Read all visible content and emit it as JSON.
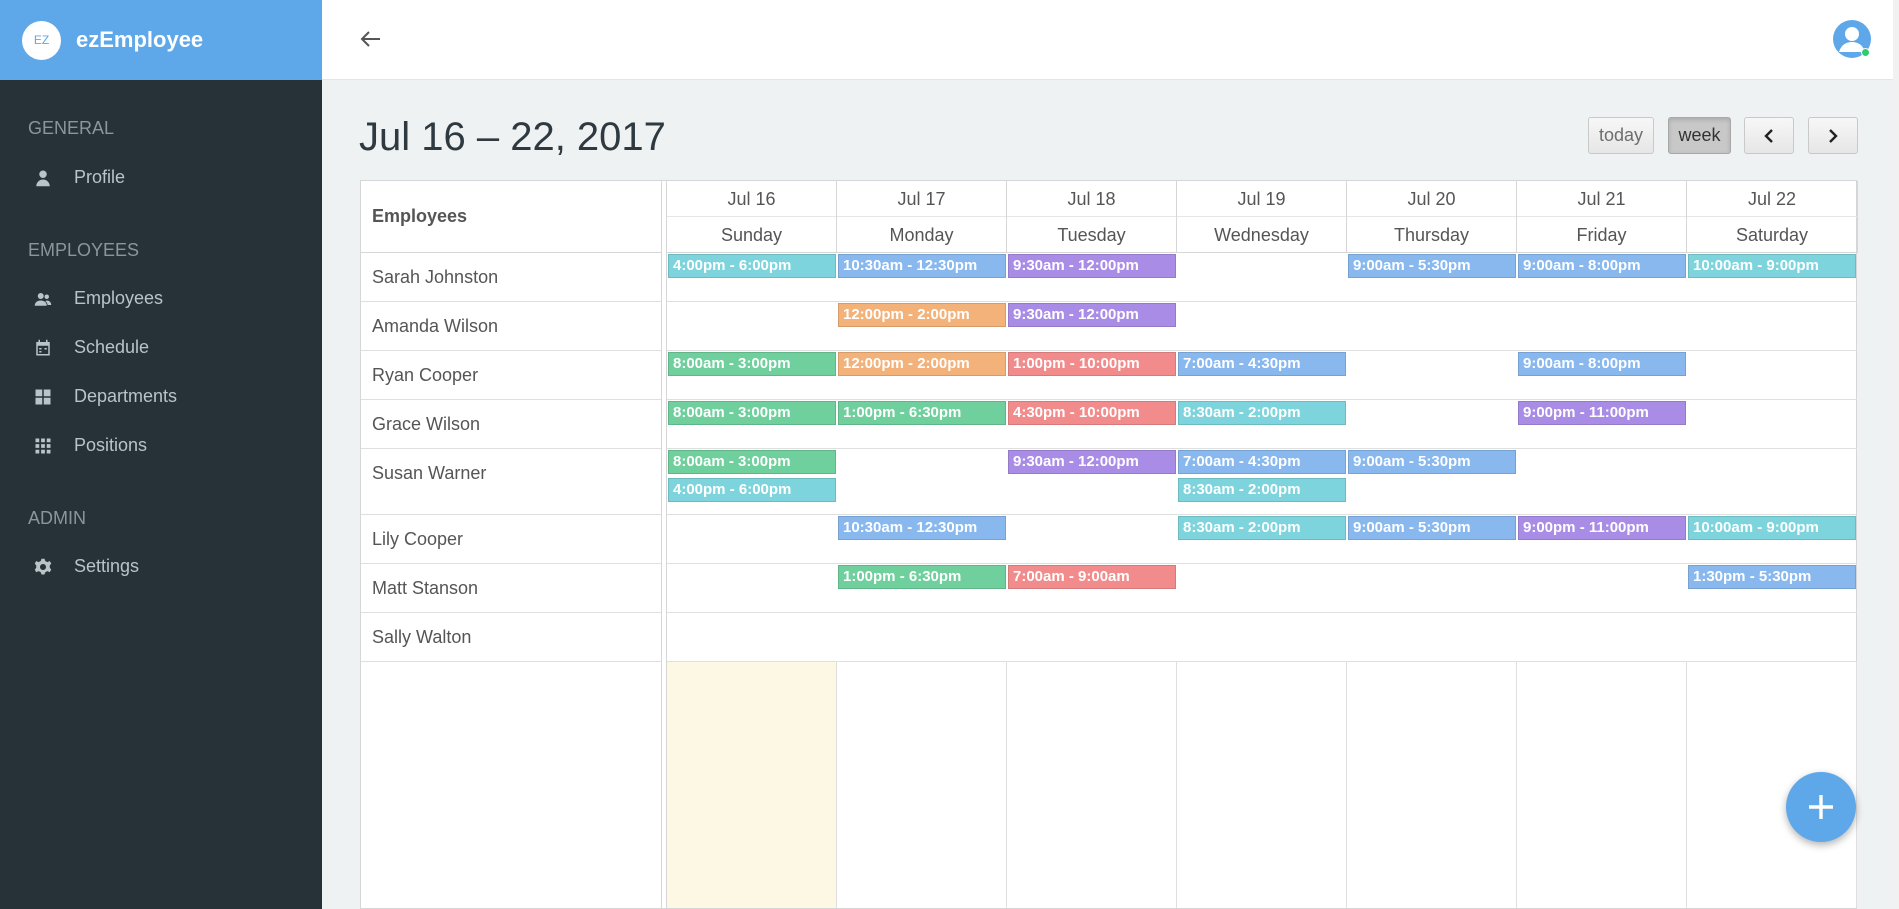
{
  "app": {
    "logo_text": "EZ",
    "name": "ezEmployee"
  },
  "sidebar": {
    "sections": [
      {
        "title": "GENERAL",
        "items": [
          {
            "label": "Profile",
            "icon": "user-icon"
          }
        ]
      },
      {
        "title": "EMPLOYEES",
        "items": [
          {
            "label": "Employees",
            "icon": "users-icon"
          },
          {
            "label": "Schedule",
            "icon": "calendar-icon"
          },
          {
            "label": "Departments",
            "icon": "grid-icon"
          },
          {
            "label": "Positions",
            "icon": "apps-icon"
          }
        ]
      },
      {
        "title": "ADMIN",
        "items": [
          {
            "label": "Settings",
            "icon": "gear-icon"
          }
        ]
      }
    ]
  },
  "toolbar": {
    "title": "Jul 16 – 22, 2017",
    "today_label": "today",
    "week_label": "week",
    "prev_icon": "chevron-left-icon",
    "next_icon": "chevron-right-icon",
    "active_view": "week"
  },
  "calendar": {
    "employees_header": "Employees",
    "days": [
      {
        "date": "Jul 16",
        "weekday": "Sunday"
      },
      {
        "date": "Jul 17",
        "weekday": "Monday"
      },
      {
        "date": "Jul 18",
        "weekday": "Tuesday"
      },
      {
        "date": "Jul 19",
        "weekday": "Wednesday"
      },
      {
        "date": "Jul 20",
        "weekday": "Thursday"
      },
      {
        "date": "Jul 21",
        "weekday": "Friday"
      },
      {
        "date": "Jul 22",
        "weekday": "Saturday"
      }
    ],
    "highlighted_day": "Jul 16",
    "employees": [
      {
        "name": "Sarah Johnston",
        "shifts": [
          {
            "day": 0,
            "slot": 0,
            "text": "4:00pm - 6:00pm",
            "color": "#7dd4dc"
          },
          {
            "day": 1,
            "slot": 0,
            "text": "10:30am - 12:30pm",
            "color": "#88b8ee"
          },
          {
            "day": 2,
            "slot": 0,
            "text": "9:30am - 12:00pm",
            "color": "#a98ce5"
          },
          {
            "day": 4,
            "slot": 0,
            "text": "9:00am - 5:30pm",
            "color": "#88b8ee"
          },
          {
            "day": 5,
            "slot": 0,
            "text": "9:00am - 8:00pm",
            "color": "#88b8ee"
          },
          {
            "day": 6,
            "slot": 0,
            "text": "10:00am - 9:00pm",
            "color": "#7dd4dc"
          }
        ]
      },
      {
        "name": "Amanda Wilson",
        "shifts": [
          {
            "day": 1,
            "slot": 0,
            "text": "12:00pm - 2:00pm",
            "color": "#f2b27a"
          },
          {
            "day": 2,
            "slot": 0,
            "text": "9:30am - 12:00pm",
            "color": "#a98ce5"
          }
        ]
      },
      {
        "name": "Ryan Cooper",
        "shifts": [
          {
            "day": 0,
            "slot": 0,
            "text": "8:00am - 3:00pm",
            "color": "#6fcf9d"
          },
          {
            "day": 1,
            "slot": 0,
            "text": "12:00pm - 2:00pm",
            "color": "#f2b27a"
          },
          {
            "day": 2,
            "slot": 0,
            "text": "1:00pm - 10:00pm",
            "color": "#f28b8b"
          },
          {
            "day": 3,
            "slot": 0,
            "text": "7:00am - 4:30pm",
            "color": "#88b8ee"
          },
          {
            "day": 5,
            "slot": 0,
            "text": "9:00am - 8:00pm",
            "color": "#88b8ee"
          }
        ]
      },
      {
        "name": "Grace Wilson",
        "shifts": [
          {
            "day": 0,
            "slot": 0,
            "text": "8:00am - 3:00pm",
            "color": "#6fcf9d"
          },
          {
            "day": 1,
            "slot": 0,
            "text": "1:00pm - 6:30pm",
            "color": "#6fcf9d"
          },
          {
            "day": 2,
            "slot": 0,
            "text": "4:30pm - 10:00pm",
            "color": "#f28b8b"
          },
          {
            "day": 3,
            "slot": 0,
            "text": "8:30am - 2:00pm",
            "color": "#7dd4dc"
          },
          {
            "day": 5,
            "slot": 0,
            "text": "9:00pm - 11:00pm",
            "color": "#a98ce5"
          }
        ]
      },
      {
        "name": "Susan Warner",
        "shifts": [
          {
            "day": 0,
            "slot": 0,
            "text": "8:00am - 3:00pm",
            "color": "#6fcf9d"
          },
          {
            "day": 0,
            "slot": 1,
            "text": "4:00pm - 6:00pm",
            "color": "#7dd4dc"
          },
          {
            "day": 2,
            "slot": 0,
            "text": "9:30am - 12:00pm",
            "color": "#a98ce5"
          },
          {
            "day": 3,
            "slot": 0,
            "text": "7:00am - 4:30pm",
            "color": "#88b8ee"
          },
          {
            "day": 3,
            "slot": 1,
            "text": "8:30am - 2:00pm",
            "color": "#7dd4dc"
          },
          {
            "day": 4,
            "slot": 0,
            "text": "9:00am - 5:30pm",
            "color": "#88b8ee"
          }
        ]
      },
      {
        "name": "Lily Cooper",
        "shifts": [
          {
            "day": 1,
            "slot": 0,
            "text": "10:30am - 12:30pm",
            "color": "#88b8ee"
          },
          {
            "day": 3,
            "slot": 0,
            "text": "8:30am - 2:00pm",
            "color": "#7dd4dc"
          },
          {
            "day": 4,
            "slot": 0,
            "text": "9:00am - 5:30pm",
            "color": "#88b8ee"
          },
          {
            "day": 5,
            "slot": 0,
            "text": "9:00pm - 11:00pm",
            "color": "#a98ce5"
          },
          {
            "day": 6,
            "slot": 0,
            "text": "10:00am - 9:00pm",
            "color": "#7dd4dc"
          }
        ]
      },
      {
        "name": "Matt Stanson",
        "shifts": [
          {
            "day": 1,
            "slot": 0,
            "text": "1:00pm - 6:30pm",
            "color": "#6fcf9d"
          },
          {
            "day": 2,
            "slot": 0,
            "text": "7:00am - 9:00am",
            "color": "#f28b8b"
          },
          {
            "day": 6,
            "slot": 0,
            "text": "1:30pm - 5:30pm",
            "color": "#88b8ee"
          }
        ]
      },
      {
        "name": "Sally Walton",
        "shifts": []
      }
    ]
  },
  "fab": {
    "icon": "plus-icon"
  },
  "header": {
    "back_icon": "arrow-left-icon",
    "avatar_icon": "avatar-icon"
  },
  "colors": {
    "brand": "#5ea8ea",
    "sidebar": "#263238",
    "today": "#fcf8e3"
  }
}
